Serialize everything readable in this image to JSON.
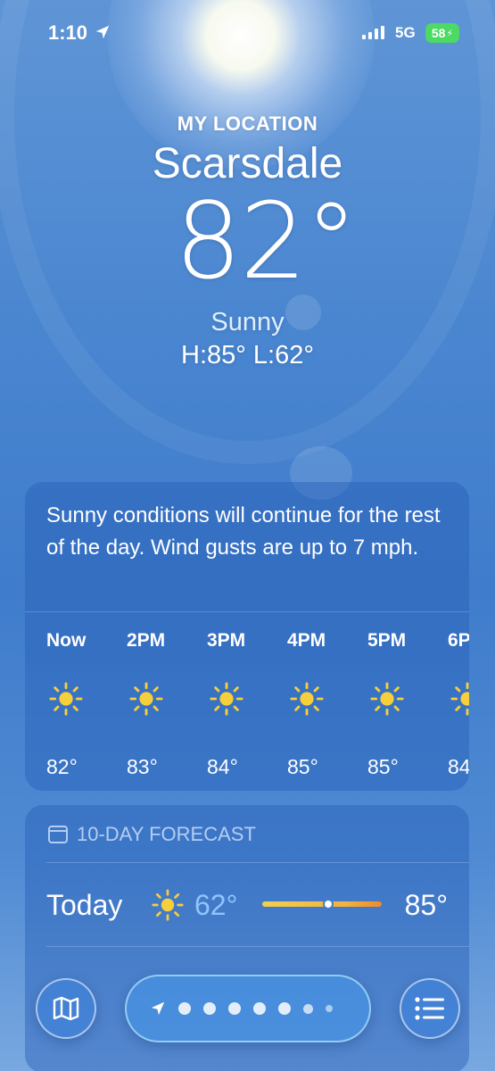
{
  "status": {
    "time": "1:10",
    "network": "5G",
    "battery": "58"
  },
  "header": {
    "location_label": "MY LOCATION",
    "city": "Scarsdale",
    "temperature": "82°",
    "condition": "Sunny",
    "high_low": "H:85°  L:62°"
  },
  "hourly": {
    "summary": "Sunny conditions will continue for the rest of the day. Wind gusts are up to 7 mph.",
    "hours": [
      {
        "label": "Now",
        "icon": "sun-icon",
        "temp": "82°"
      },
      {
        "label": "2PM",
        "icon": "sun-icon",
        "temp": "83°"
      },
      {
        "label": "3PM",
        "icon": "sun-icon",
        "temp": "84°"
      },
      {
        "label": "4PM",
        "icon": "sun-icon",
        "temp": "85°"
      },
      {
        "label": "5PM",
        "icon": "sun-icon",
        "temp": "85°"
      },
      {
        "label": "6P",
        "icon": "sun-icon",
        "temp": "84"
      }
    ]
  },
  "ten_day": {
    "title": "10-DAY FORECAST",
    "rows": [
      {
        "day": "Today",
        "icon": "sun-icon",
        "low": "62°",
        "high": "85°",
        "current_position": 0.55
      }
    ]
  },
  "toolbar": {
    "map_icon": "map-icon",
    "location_icon": "location-arrow-icon",
    "list_icon": "list-icon",
    "page_count": 7
  },
  "colors": {
    "sun": "#f6cf3a",
    "battery": "#4cd964",
    "low_temp": "#96c8ff"
  }
}
